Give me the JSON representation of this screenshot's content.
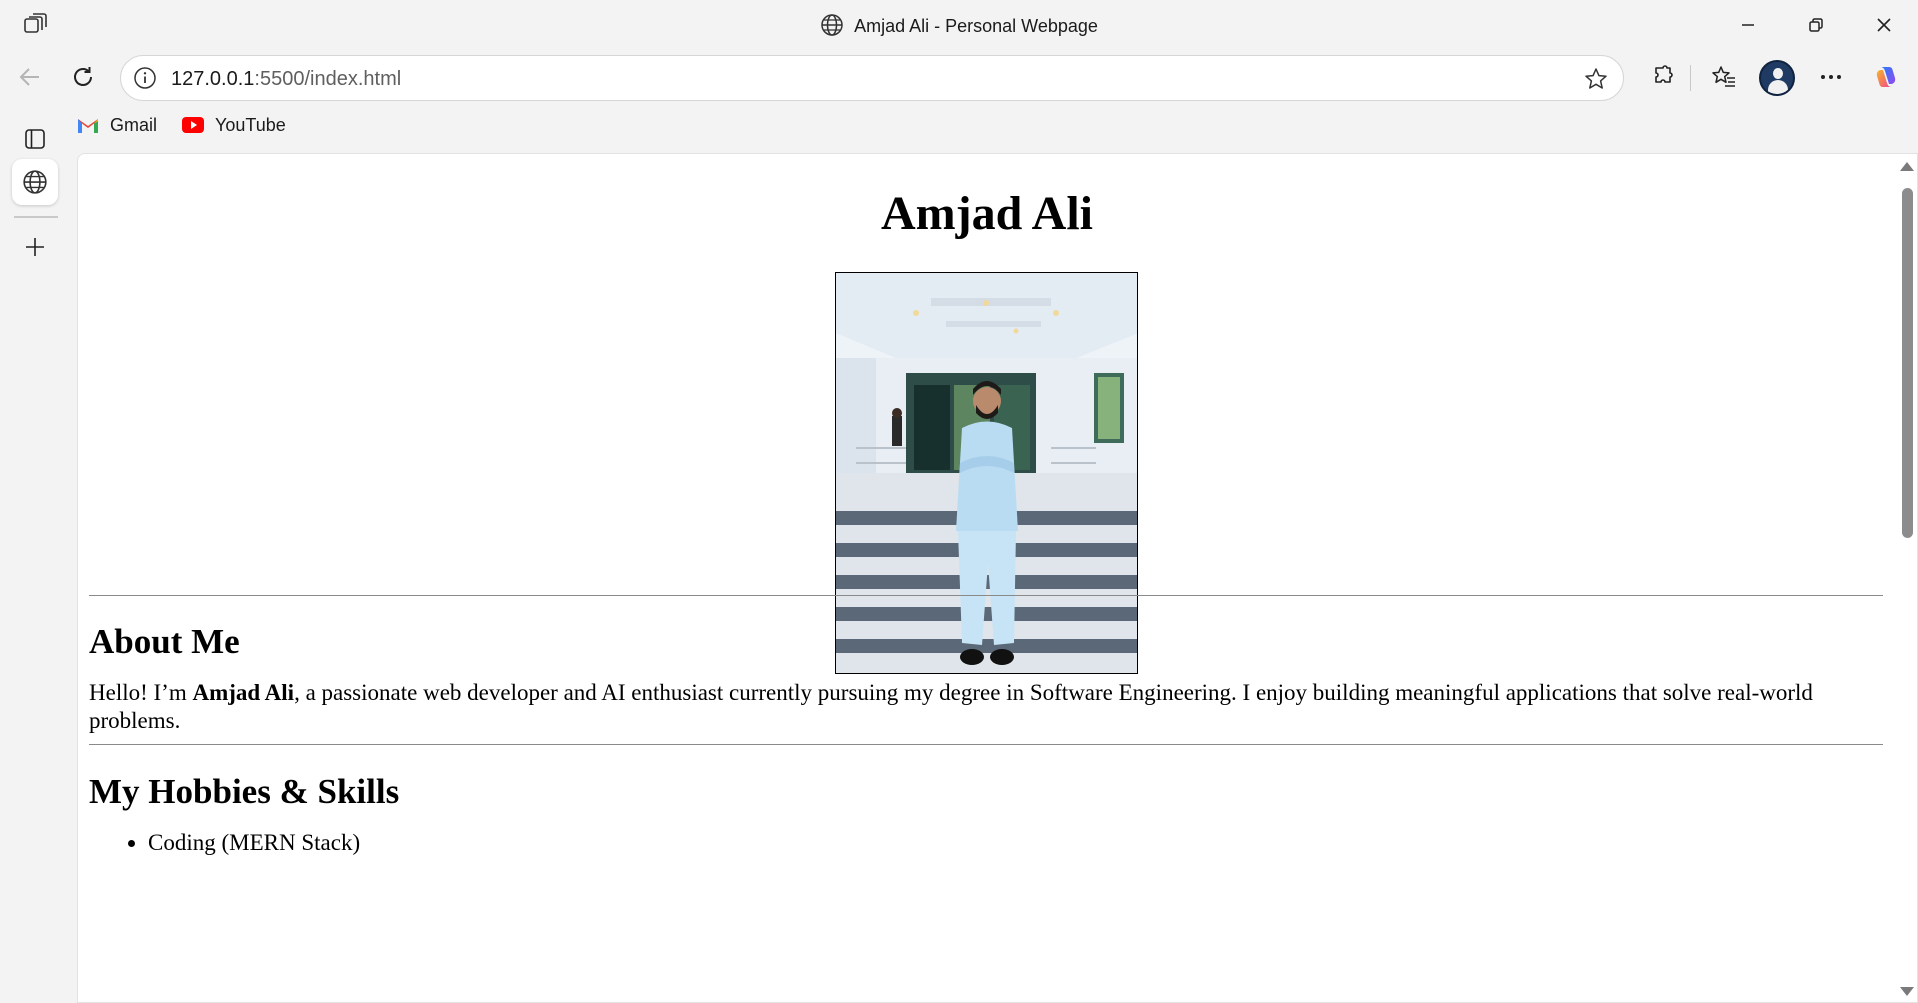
{
  "window": {
    "title": "Amjad Ali - Personal Webpage"
  },
  "address_bar": {
    "url_host": "127.0.0.1",
    "url_rest": ":5500/index.html"
  },
  "bookmarks": [
    {
      "label": "Gmail",
      "icon": "gmail-icon"
    },
    {
      "label": "YouTube",
      "icon": "youtube-icon"
    }
  ],
  "page": {
    "heading": "Amjad Ali",
    "photo_alt": "Amjad Ali",
    "about": {
      "title": "About Me",
      "intro_start": "Hello! I’m ",
      "name_bold": "Amjad Ali",
      "intro_rest": ", a passionate web developer and AI enthusiast currently pursuing my degree in Software Engineering. I enjoy building meaningful applications that solve real-world problems."
    },
    "hobbies": {
      "title": "My Hobbies & Skills",
      "items": [
        "Coding (MERN Stack)"
      ]
    }
  },
  "colors": {
    "chrome_bg": "#f3f3f3",
    "page_bg": "#ffffff",
    "rule": "#8a8a8a"
  }
}
